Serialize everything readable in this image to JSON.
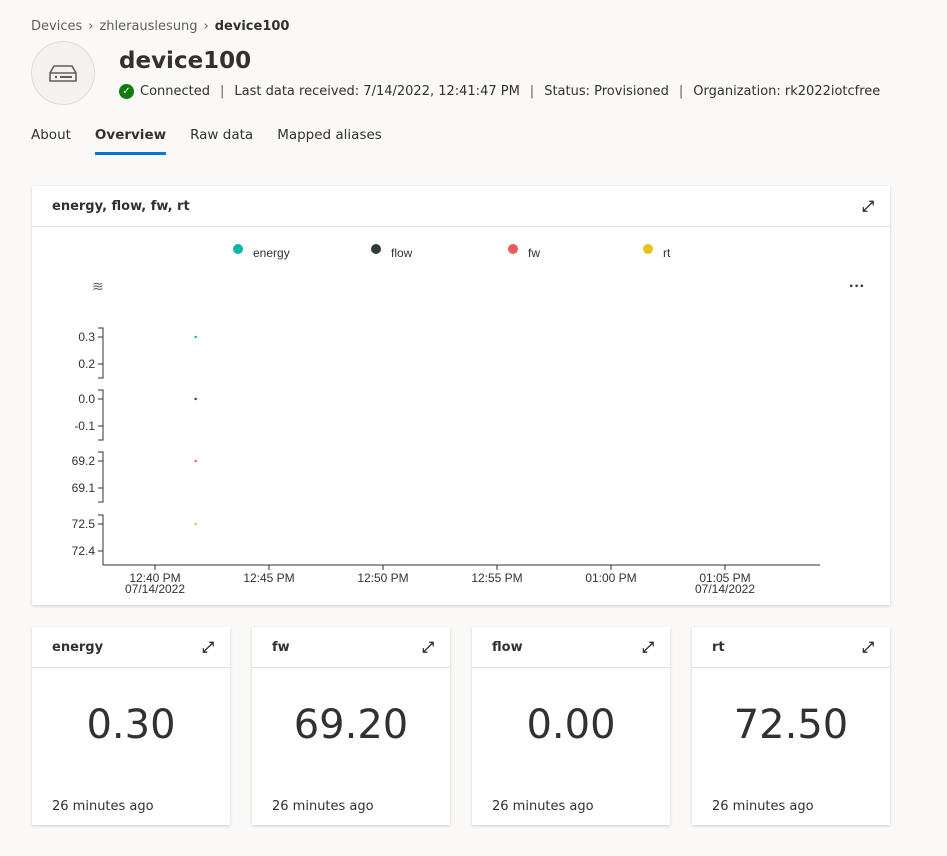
{
  "breadcrumb": {
    "items": [
      "Devices",
      "zhlerauslesung",
      "device100"
    ]
  },
  "device": {
    "name": "device100",
    "status": "Connected",
    "last_data": "Last data received: 7/14/2022, 12:41:47 PM",
    "provision": "Status: Provisioned",
    "organization": "Organization: rk2022iotcfree",
    "icon": "device-icon"
  },
  "tabs": [
    {
      "label": "About"
    },
    {
      "label": "Overview",
      "active": true
    },
    {
      "label": "Raw data"
    },
    {
      "label": "Mapped aliases"
    }
  ],
  "chart_card": {
    "title": "energy, flow, fw, rt"
  },
  "chart_data": {
    "type": "scatter",
    "legend_placement": "top",
    "x_ticks": [
      "12:40 PM",
      "12:45 PM",
      "12:50 PM",
      "12:55 PM",
      "01:00 PM",
      "01:05 PM"
    ],
    "x_tick_dates": {
      "0": "07/14/2022",
      "5": "07/14/2022"
    },
    "x_range": [
      "12:39",
      "13:10"
    ],
    "series": [
      {
        "name": "energy",
        "color": "#00b7a8",
        "x": [
          "12:41:47"
        ],
        "y": [
          0.3
        ],
        "y_ticks": [
          "0.3",
          "0.2"
        ],
        "y_tick_values": [
          0.3,
          0.2
        ]
      },
      {
        "name": "flow",
        "color": "#2f3b3b",
        "x": [
          "12:41:47"
        ],
        "y": [
          0.0
        ],
        "y_ticks": [
          "0.0",
          "-0.1"
        ],
        "y_tick_values": [
          0.0,
          -0.1
        ]
      },
      {
        "name": "fw",
        "color": "#f0595a",
        "x": [
          "12:41:47"
        ],
        "y": [
          69.2
        ],
        "y_ticks": [
          "69.2",
          "69.1"
        ],
        "y_tick_values": [
          69.2,
          69.1
        ]
      },
      {
        "name": "rt",
        "color": "#e8c11b",
        "x": [
          "12:41:47"
        ],
        "y": [
          72.5
        ],
        "y_ticks": [
          "72.5",
          "72.4"
        ],
        "y_tick_values": [
          72.5,
          72.4
        ]
      }
    ]
  },
  "tiles": [
    {
      "title": "energy",
      "value": "0.30",
      "ago": "26 minutes ago"
    },
    {
      "title": "fw",
      "value": "69.20",
      "ago": "26 minutes ago"
    },
    {
      "title": "flow",
      "value": "0.00",
      "ago": "26 minutes ago"
    },
    {
      "title": "rt",
      "value": "72.50",
      "ago": "26 minutes ago"
    }
  ]
}
